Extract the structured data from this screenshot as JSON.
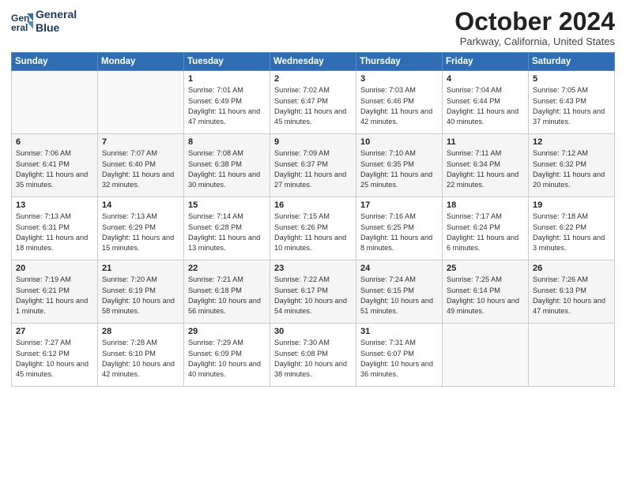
{
  "header": {
    "logo_line1": "General",
    "logo_line2": "Blue",
    "month": "October 2024",
    "location": "Parkway, California, United States"
  },
  "weekdays": [
    "Sunday",
    "Monday",
    "Tuesday",
    "Wednesday",
    "Thursday",
    "Friday",
    "Saturday"
  ],
  "weeks": [
    [
      {
        "day": "",
        "info": ""
      },
      {
        "day": "",
        "info": ""
      },
      {
        "day": "1",
        "info": "Sunrise: 7:01 AM\nSunset: 6:49 PM\nDaylight: 11 hours and 47 minutes."
      },
      {
        "day": "2",
        "info": "Sunrise: 7:02 AM\nSunset: 6:47 PM\nDaylight: 11 hours and 45 minutes."
      },
      {
        "day": "3",
        "info": "Sunrise: 7:03 AM\nSunset: 6:46 PM\nDaylight: 11 hours and 42 minutes."
      },
      {
        "day": "4",
        "info": "Sunrise: 7:04 AM\nSunset: 6:44 PM\nDaylight: 11 hours and 40 minutes."
      },
      {
        "day": "5",
        "info": "Sunrise: 7:05 AM\nSunset: 6:43 PM\nDaylight: 11 hours and 37 minutes."
      }
    ],
    [
      {
        "day": "6",
        "info": "Sunrise: 7:06 AM\nSunset: 6:41 PM\nDaylight: 11 hours and 35 minutes."
      },
      {
        "day": "7",
        "info": "Sunrise: 7:07 AM\nSunset: 6:40 PM\nDaylight: 11 hours and 32 minutes."
      },
      {
        "day": "8",
        "info": "Sunrise: 7:08 AM\nSunset: 6:38 PM\nDaylight: 11 hours and 30 minutes."
      },
      {
        "day": "9",
        "info": "Sunrise: 7:09 AM\nSunset: 6:37 PM\nDaylight: 11 hours and 27 minutes."
      },
      {
        "day": "10",
        "info": "Sunrise: 7:10 AM\nSunset: 6:35 PM\nDaylight: 11 hours and 25 minutes."
      },
      {
        "day": "11",
        "info": "Sunrise: 7:11 AM\nSunset: 6:34 PM\nDaylight: 11 hours and 22 minutes."
      },
      {
        "day": "12",
        "info": "Sunrise: 7:12 AM\nSunset: 6:32 PM\nDaylight: 11 hours and 20 minutes."
      }
    ],
    [
      {
        "day": "13",
        "info": "Sunrise: 7:13 AM\nSunset: 6:31 PM\nDaylight: 11 hours and 18 minutes."
      },
      {
        "day": "14",
        "info": "Sunrise: 7:13 AM\nSunset: 6:29 PM\nDaylight: 11 hours and 15 minutes."
      },
      {
        "day": "15",
        "info": "Sunrise: 7:14 AM\nSunset: 6:28 PM\nDaylight: 11 hours and 13 minutes."
      },
      {
        "day": "16",
        "info": "Sunrise: 7:15 AM\nSunset: 6:26 PM\nDaylight: 11 hours and 10 minutes."
      },
      {
        "day": "17",
        "info": "Sunrise: 7:16 AM\nSunset: 6:25 PM\nDaylight: 11 hours and 8 minutes."
      },
      {
        "day": "18",
        "info": "Sunrise: 7:17 AM\nSunset: 6:24 PM\nDaylight: 11 hours and 6 minutes."
      },
      {
        "day": "19",
        "info": "Sunrise: 7:18 AM\nSunset: 6:22 PM\nDaylight: 11 hours and 3 minutes."
      }
    ],
    [
      {
        "day": "20",
        "info": "Sunrise: 7:19 AM\nSunset: 6:21 PM\nDaylight: 11 hours and 1 minute."
      },
      {
        "day": "21",
        "info": "Sunrise: 7:20 AM\nSunset: 6:19 PM\nDaylight: 10 hours and 58 minutes."
      },
      {
        "day": "22",
        "info": "Sunrise: 7:21 AM\nSunset: 6:18 PM\nDaylight: 10 hours and 56 minutes."
      },
      {
        "day": "23",
        "info": "Sunrise: 7:22 AM\nSunset: 6:17 PM\nDaylight: 10 hours and 54 minutes."
      },
      {
        "day": "24",
        "info": "Sunrise: 7:24 AM\nSunset: 6:15 PM\nDaylight: 10 hours and 51 minutes."
      },
      {
        "day": "25",
        "info": "Sunrise: 7:25 AM\nSunset: 6:14 PM\nDaylight: 10 hours and 49 minutes."
      },
      {
        "day": "26",
        "info": "Sunrise: 7:26 AM\nSunset: 6:13 PM\nDaylight: 10 hours and 47 minutes."
      }
    ],
    [
      {
        "day": "27",
        "info": "Sunrise: 7:27 AM\nSunset: 6:12 PM\nDaylight: 10 hours and 45 minutes."
      },
      {
        "day": "28",
        "info": "Sunrise: 7:28 AM\nSunset: 6:10 PM\nDaylight: 10 hours and 42 minutes."
      },
      {
        "day": "29",
        "info": "Sunrise: 7:29 AM\nSunset: 6:09 PM\nDaylight: 10 hours and 40 minutes."
      },
      {
        "day": "30",
        "info": "Sunrise: 7:30 AM\nSunset: 6:08 PM\nDaylight: 10 hours and 38 minutes."
      },
      {
        "day": "31",
        "info": "Sunrise: 7:31 AM\nSunset: 6:07 PM\nDaylight: 10 hours and 36 minutes."
      },
      {
        "day": "",
        "info": ""
      },
      {
        "day": "",
        "info": ""
      }
    ]
  ]
}
